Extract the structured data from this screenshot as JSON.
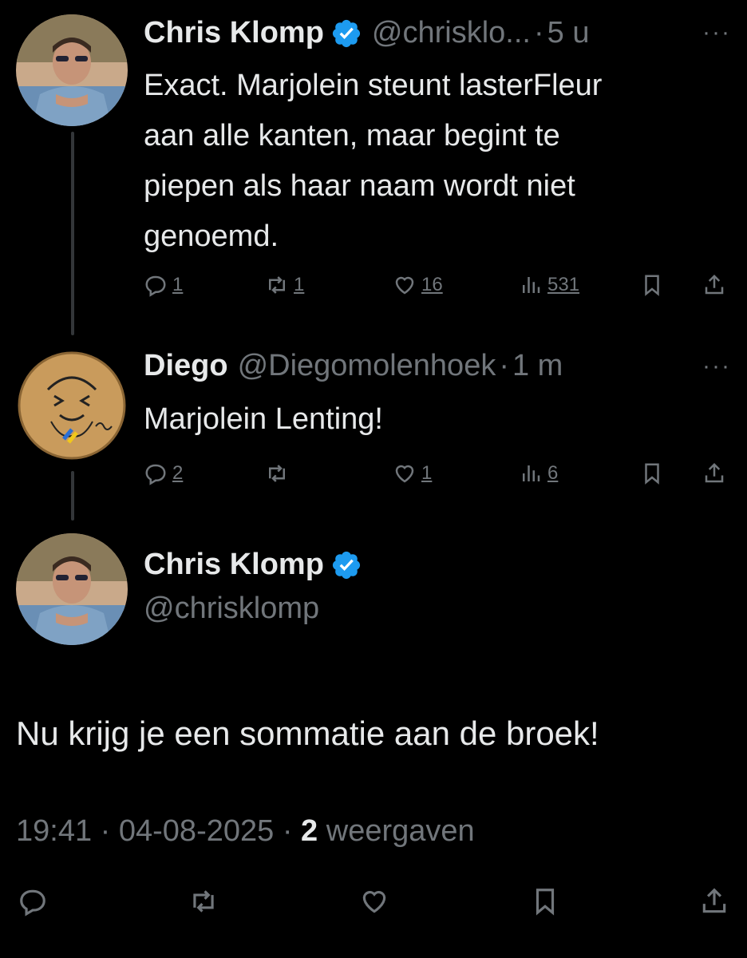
{
  "tweet1": {
    "name": "Chris Klomp",
    "handle": "@chrisklo...",
    "dot": "·",
    "time": "5 u",
    "text_lines": [
      "Exact. Marjolein steunt lasterFleur",
      "aan alle kanten, maar begint te",
      "piepen als haar naam wordt niet",
      "genoemd."
    ],
    "actions": {
      "replies": "1",
      "retweets": "1",
      "likes": "16",
      "views": "531"
    }
  },
  "tweet2": {
    "name": "Diego",
    "handle": "@Diegomolenhoek",
    "dot": "·",
    "time": "1 m",
    "text": "Marjolein Lenting!",
    "actions": {
      "replies": "2",
      "retweets": "",
      "likes": "1",
      "views": "6"
    }
  },
  "main_tweet": {
    "name": "Chris Klomp",
    "handle": "@chrisklomp",
    "text": "Nu krijg je een sommatie aan de broek!",
    "time": "19:41",
    "date": "04-08-2025",
    "views_count": "2",
    "views_label": "weergaven",
    "dot": "·"
  },
  "more_icon": "···",
  "colors": {
    "background": "#000000",
    "text": "#e7e9ea",
    "muted": "#71767b",
    "verified": "#1d9bf0"
  }
}
